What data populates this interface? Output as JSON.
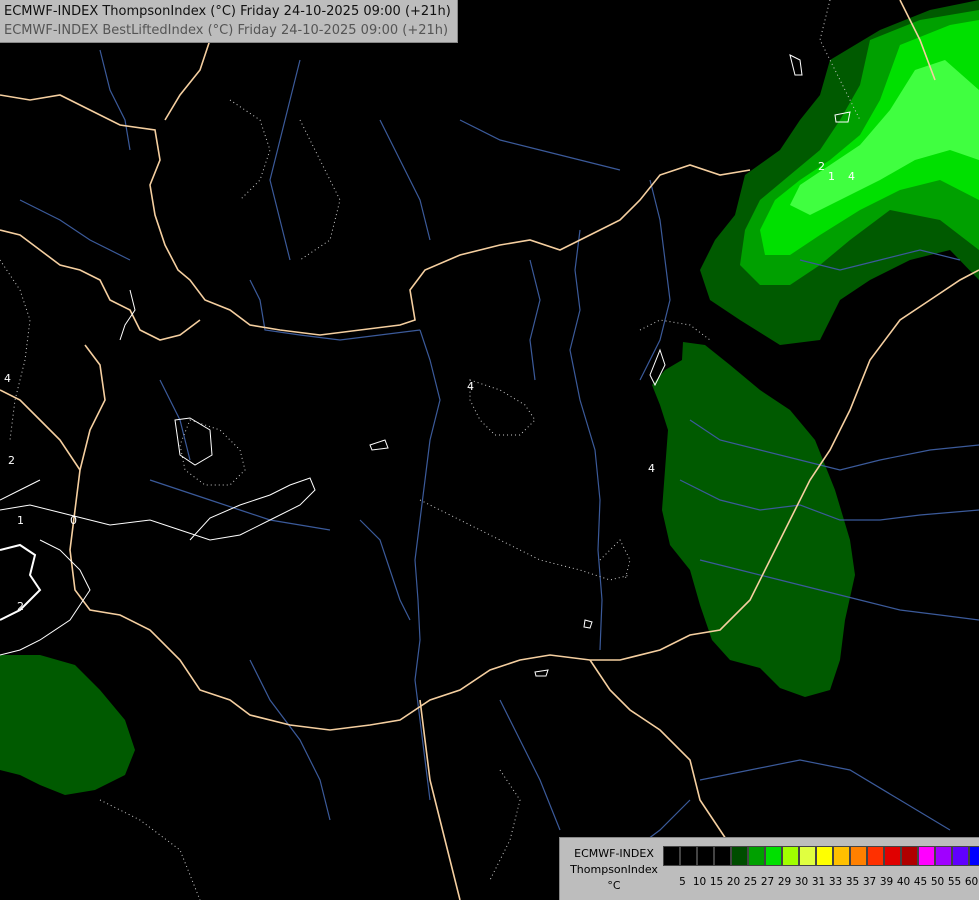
{
  "header": {
    "line1": "ECMWF-INDEX ThompsonIndex (°C) Friday 24-10-2025 09:00 (+21h)",
    "line2": "ECMWF-INDEX BestLiftedIndex (°C) Friday 24-10-2025 09:00 (+21h)"
  },
  "legend": {
    "line1": "ECMWF-INDEX",
    "line2": "ThompsonIndex",
    "line3": "°C",
    "ticks": [
      "5",
      "10",
      "15",
      "20",
      "25",
      "27",
      "29",
      "30",
      "31",
      "33",
      "35",
      "37",
      "39",
      "40",
      "45",
      "50",
      "55",
      "60"
    ],
    "colors": [
      "#000000",
      "#000000",
      "#000000",
      "#000000",
      "#004d00",
      "#00a000",
      "#00e000",
      "#a0ff00",
      "#e0ff40",
      "#ffff00",
      "#ffc000",
      "#ff8000",
      "#ff3000",
      "#e00000",
      "#b00000",
      "#ff00ff",
      "#a000ff",
      "#6000ff",
      "#0000ff"
    ]
  },
  "contour_labels": [
    "4",
    "2",
    "1",
    "0",
    "2",
    "4",
    "4",
    "2",
    "1",
    "4"
  ],
  "colors": {
    "background": "#000000",
    "border": "#f5cfa0",
    "river": "#3b5a9a",
    "dotted": "#cccccc",
    "contour": "#ffffff",
    "green_dark": "#005a00",
    "green_mid": "#00a000",
    "green_bright": "#00ee00",
    "green_light": "#40ff40"
  }
}
